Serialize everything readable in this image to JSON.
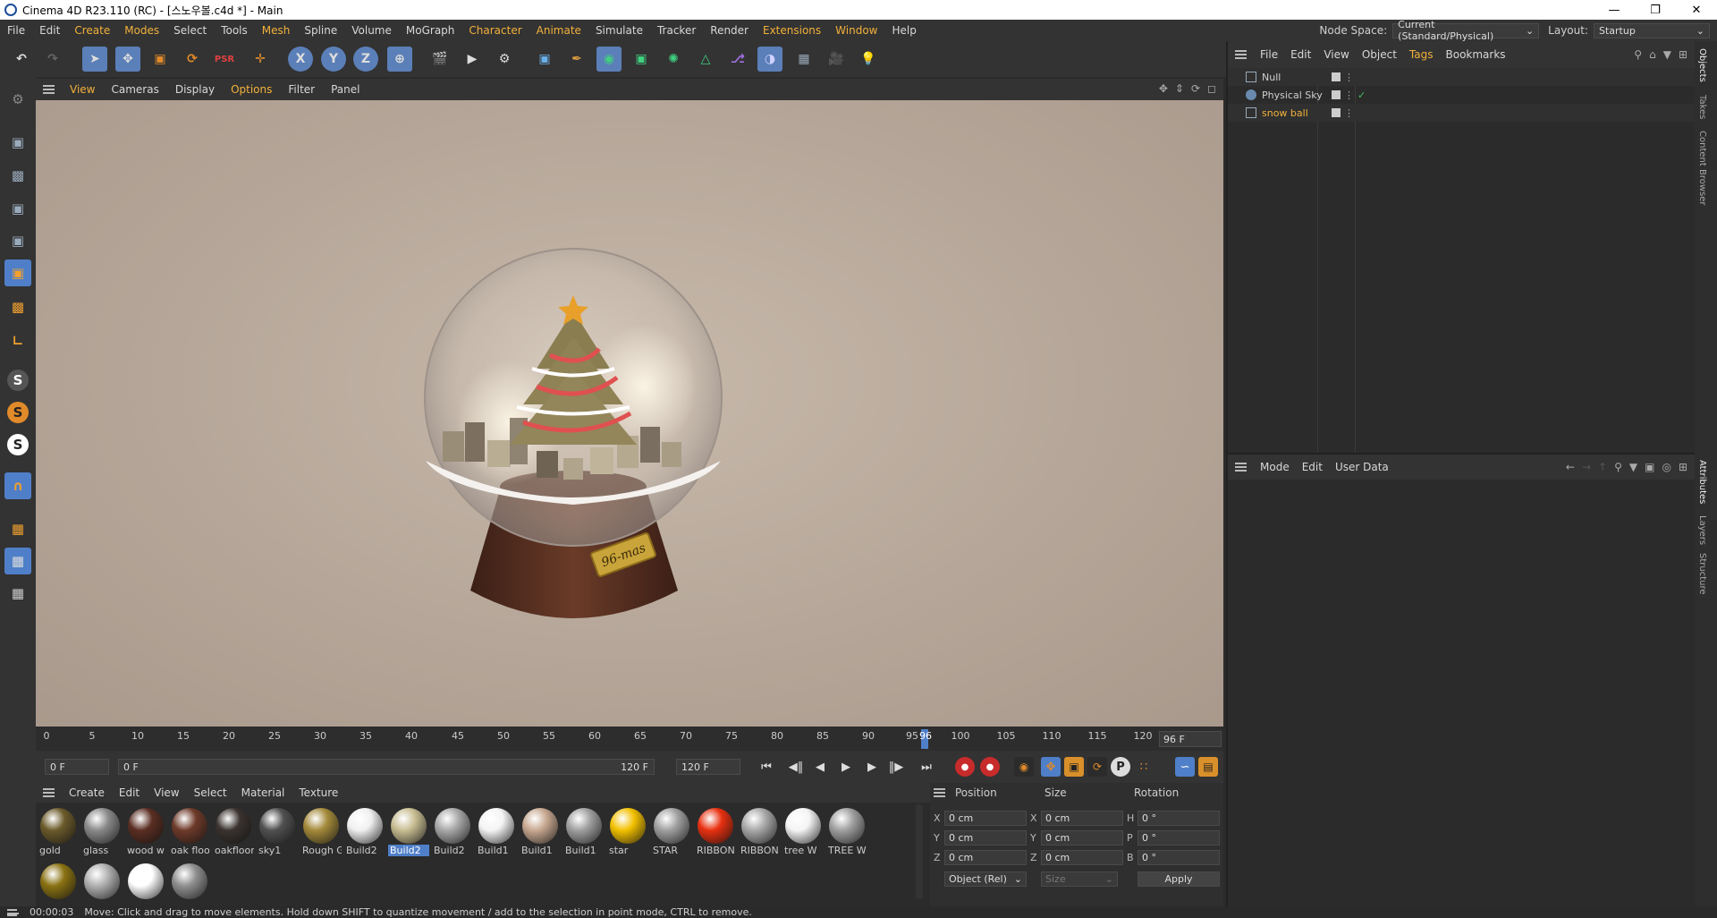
{
  "window": {
    "title": "Cinema 4D R23.110 (RC) - [스노우볼.c4d *] - Main"
  },
  "menubar": {
    "items": [
      "File",
      "Edit",
      "Create",
      "Modes",
      "Select",
      "Tools",
      "Mesh",
      "Spline",
      "Volume",
      "MoGraph",
      "Character",
      "Animate",
      "Simulate",
      "Tracker",
      "Render",
      "Extensions",
      "Window",
      "Help"
    ],
    "node_space_label": "Node Space:",
    "node_space_value": "Current (Standard/Physical)",
    "layout_label": "Layout:",
    "layout_value": "Startup"
  },
  "toolbar": {
    "axis_x": "X",
    "axis_y": "Y",
    "axis_z": "Z"
  },
  "viewport": {
    "menu": [
      "View",
      "Cameras",
      "Display",
      "Options",
      "Filter",
      "Panel"
    ],
    "plaque_text": "96-mas"
  },
  "timeline": {
    "ticks": [
      "0",
      "5",
      "10",
      "15",
      "20",
      "25",
      "30",
      "35",
      "40",
      "45",
      "50",
      "55",
      "60",
      "65",
      "70",
      "75",
      "80",
      "85",
      "90",
      "95",
      "96",
      "100",
      "105",
      "110",
      "115",
      "120"
    ],
    "current_frame": "96 F",
    "start_field": "0 F",
    "range_left": "0 F",
    "range_right": "120 F",
    "end_field": "120 F"
  },
  "materials": {
    "menu": [
      "Create",
      "Edit",
      "View",
      "Select",
      "Material",
      "Texture"
    ],
    "items": [
      {
        "label": "gold",
        "color": "#6b5a2a"
      },
      {
        "label": "glass",
        "color": "#8a8a8a"
      },
      {
        "label": "wood w",
        "color": "#5a2e22"
      },
      {
        "label": "oak floo",
        "color": "#6e3a2a"
      },
      {
        "label": "oakfloor",
        "color": "#3a3330"
      },
      {
        "label": "sky1",
        "color": "#505050"
      },
      {
        "label": "Rough G",
        "color": "#a48a3a"
      },
      {
        "label": "Build2",
        "color": "#f0f0f0"
      },
      {
        "label": "Build2",
        "color": "#c8bd92"
      },
      {
        "label": "Build2",
        "color": "#a8a8a8"
      },
      {
        "label": "Build1",
        "color": "#f4f4f4"
      },
      {
        "label": "Build1",
        "color": "#c8a890"
      },
      {
        "label": "Build1",
        "color": "#a0a0a0"
      },
      {
        "label": "star",
        "color": "#f2c000"
      },
      {
        "label": "STAR",
        "color": "#a0a0a0"
      },
      {
        "label": "RIBBON",
        "color": "#e83010"
      },
      {
        "label": "RIBBON",
        "color": "#a8a8a8"
      },
      {
        "label": "tree W",
        "color": "#f4f4f4"
      },
      {
        "label": "TREE W",
        "color": "#a0a0a0"
      },
      {
        "label": "",
        "color": "#8a7212"
      },
      {
        "label": "",
        "color": "#b0b0b0"
      },
      {
        "label": "",
        "color": "#ffffff"
      },
      {
        "label": "",
        "color": "#8f8f8f"
      }
    ],
    "selected_index": 8
  },
  "coordinates": {
    "headers": [
      "Position",
      "Size",
      "Rotation"
    ],
    "rows": [
      {
        "axis": "X",
        "pos": "0 cm",
        "size_axis": "X",
        "size": "0 cm",
        "rot_axis": "H",
        "rot": "0 °"
      },
      {
        "axis": "Y",
        "pos": "0 cm",
        "size_axis": "Y",
        "size": "0 cm",
        "rot_axis": "P",
        "rot": "0 °"
      },
      {
        "axis": "Z",
        "pos": "0 cm",
        "size_axis": "Z",
        "size": "0 cm",
        "rot_axis": "B",
        "rot": "0 °"
      }
    ],
    "mode_value": "Object (Rel)",
    "size_mode": "Size",
    "apply_label": "Apply"
  },
  "object_manager": {
    "menu": [
      "File",
      "Edit",
      "View",
      "Object",
      "Tags",
      "Bookmarks"
    ],
    "objects": [
      {
        "name": "Null",
        "highlight": false
      },
      {
        "name": "Physical Sky",
        "highlight": false
      },
      {
        "name": "snow ball",
        "highlight": true
      }
    ]
  },
  "attribute_manager": {
    "menu": [
      "Mode",
      "Edit",
      "User Data"
    ]
  },
  "side_tabs": [
    "Objects",
    "Takes",
    "Content Browser",
    "Attributes",
    "Layers",
    "Structure"
  ],
  "status": {
    "time": "00:00:03",
    "message": "Move: Click and drag to move elements. Hold down SHIFT to quantize movement / add to the selection in point mode, CTRL to remove."
  }
}
